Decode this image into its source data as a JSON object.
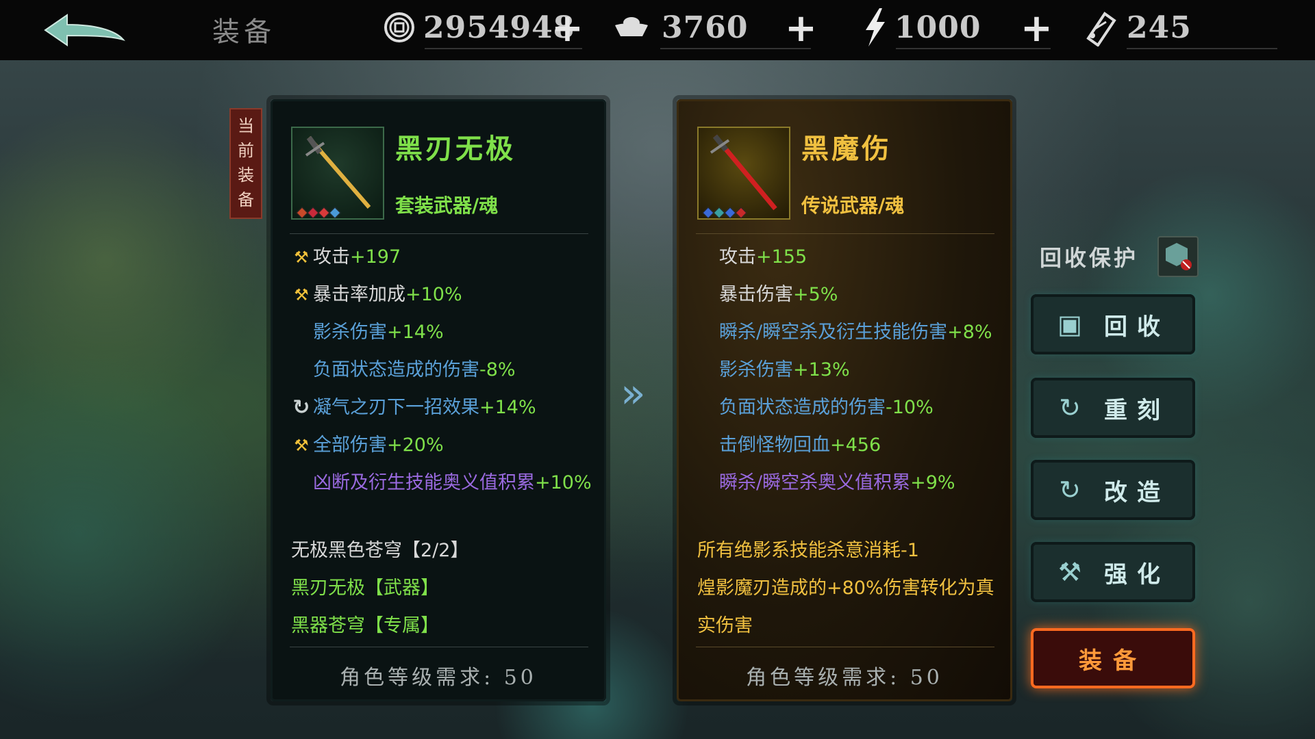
{
  "header": {
    "title": "装备",
    "currencies": [
      {
        "icon": "coin-icon",
        "value": "2954948"
      },
      {
        "icon": "silver-ingot-icon",
        "value": "3760"
      },
      {
        "icon": "stamina-bolt-icon",
        "value": "1000"
      },
      {
        "icon": "ticket-icon",
        "value": "245"
      }
    ],
    "plus": "+"
  },
  "current_tag": "当\n前\n装\n备",
  "left_item": {
    "name": "黑刃无极",
    "type": "套装武器/魂",
    "stats": [
      {
        "icon": "hammer",
        "label": "攻击",
        "value": "+197",
        "color": "#d8d8d8",
        "vcolor": "#7fe04a"
      },
      {
        "icon": "hammer",
        "label": "暴击率加成",
        "value": "+10%",
        "color": "#d8d8d8",
        "vcolor": "#7fe04a"
      },
      {
        "icon": "",
        "label": "影杀伤害",
        "value": "+14%",
        "color": "#5aa0d8",
        "vcolor": "#7fe04a"
      },
      {
        "icon": "",
        "label": "负面状态造成的伤害",
        "value": "-8%",
        "color": "#5aa0d8",
        "vcolor": "#7fe04a"
      },
      {
        "icon": "refresh",
        "label": "凝气之刃下一招效果",
        "value": "+14%",
        "color": "#5aa0d8",
        "vcolor": "#7fe04a"
      },
      {
        "icon": "hammer",
        "label": "全部伤害",
        "value": "+20%",
        "color": "#5aa0d8",
        "vcolor": "#7fe04a"
      },
      {
        "icon": "",
        "label": "凶断及衍生技能奥义值积累",
        "value": "+10%",
        "color": "#9a6ae0",
        "vcolor": "#7fe04a"
      }
    ],
    "set_title": "无极黑色苍穹【2/2】",
    "set_items": [
      "黑刃无极【武器】",
      "黑器苍穹【专属】"
    ],
    "requirement": "角色等级需求: 50"
  },
  "right_item": {
    "name": "黑魔伤",
    "type": "传说武器/魂",
    "stats": [
      {
        "label": "攻击",
        "value": "+155",
        "color": "#d8d8d8",
        "vcolor": "#7fe04a"
      },
      {
        "label": "暴击伤害",
        "value": "+5%",
        "color": "#d8d8d8",
        "vcolor": "#7fe04a"
      },
      {
        "label": "瞬杀/瞬空杀及衍生技能伤害",
        "value": "+8%",
        "color": "#5aa0d8",
        "vcolor": "#7fe04a"
      },
      {
        "label": "影杀伤害",
        "value": "+13%",
        "color": "#5aa0d8",
        "vcolor": "#7fe04a"
      },
      {
        "label": "负面状态造成的伤害",
        "value": "-10%",
        "color": "#5aa0d8",
        "vcolor": "#7fe04a"
      },
      {
        "label": "击倒怪物回血",
        "value": "+456",
        "color": "#5aa0d8",
        "vcolor": "#7fe04a"
      },
      {
        "label": "瞬杀/瞬空杀奥义值积累",
        "value": "+9%",
        "color": "#9a6ae0",
        "vcolor": "#7fe04a"
      }
    ],
    "effects": [
      "所有绝影系技能杀意消耗-1",
      "煌影魔刃造成的+80%伤害转化为真",
      "实伤害"
    ],
    "requirement": "角色等级需求: 50"
  },
  "side": {
    "protect_label": "回收保护",
    "buttons": [
      {
        "icon": "recycle-icon",
        "glyph": "▣",
        "label": "回收"
      },
      {
        "icon": "reforge-icon",
        "glyph": "↻",
        "label": "重刻"
      },
      {
        "icon": "modify-icon",
        "glyph": "↻",
        "label": "改造"
      },
      {
        "icon": "enhance-icon",
        "glyph": "⚒",
        "label": "强化"
      }
    ],
    "equip_label": "装备"
  }
}
